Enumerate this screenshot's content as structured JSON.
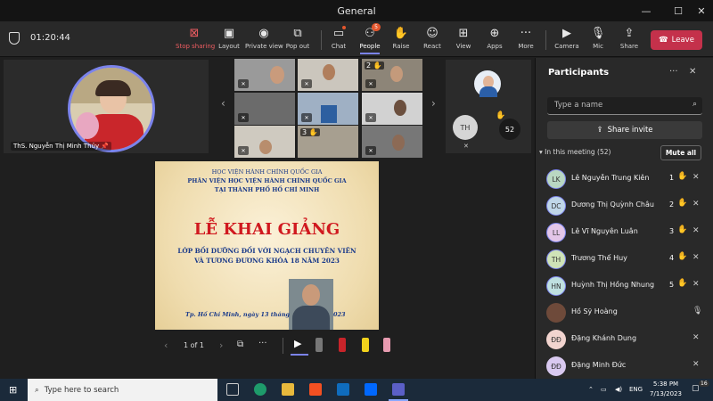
{
  "window": {
    "title": "General",
    "minimize": "—",
    "maximize": "☐",
    "close": "✕"
  },
  "toolbar": {
    "timer": "01:20:44",
    "stop_sharing": "Stop sharing",
    "layout": "Layout",
    "private_view": "Private view",
    "pop_out": "Pop out",
    "chat": "Chat",
    "people": "People",
    "people_badge": "5",
    "raise": "Raise",
    "react": "React",
    "view": "View",
    "apps": "Apps",
    "more": "More",
    "camera": "Camera",
    "mic": "Mic",
    "share": "Share",
    "leave": "Leave"
  },
  "stage": {
    "presenter_name": "ThS. Nguyễn Thị Minh Thủy",
    "hand_2": "2",
    "hand_3": "3",
    "side_initials": "TH",
    "side_count": "52"
  },
  "slide": {
    "line1": "HỌC VIỆN HÀNH CHÍNH QUỐC GIA",
    "line2": "PHÂN VIỆN HỌC VIỆN HÀNH CHÍNH QUỐC GIA",
    "line3": "TẠI THÀNH PHỐ HỒ CHÍ MINH",
    "title": "LỄ KHAI GIẢNG",
    "sub1": "LỚP BỒI DƯỠNG ĐỐI VỚI NGẠCH CHUYÊN VIÊN",
    "sub2": "VÀ TƯƠNG ĐƯƠNG KHÓA 18 NĂM 2023",
    "footer_left": "Tp. Hồ Chí Minh, ngày 13 tháng",
    "footer_right": "023",
    "page": "1 of 1"
  },
  "panel": {
    "title": "Participants",
    "search_placeholder": "Type a name",
    "invite": "Share invite",
    "in_meeting": "In this meeting (52)",
    "mute_all": "Mute all",
    "people": [
      {
        "initials": "LK",
        "name": "Lê Nguyễn Trung Kiên",
        "hand": "1",
        "color": "#b9d7c2"
      },
      {
        "initials": "DC",
        "name": "Dương Thị Quỳnh Châu",
        "hand": "2",
        "color": "#bfd6e8"
      },
      {
        "initials": "LL",
        "name": "Lê Vĩ Nguyên Luân",
        "hand": "3",
        "color": "#e3c6e8"
      },
      {
        "initials": "TH",
        "name": "Trương Thế Huy",
        "hand": "4",
        "color": "#cfe3b7"
      },
      {
        "initials": "HN",
        "name": "Huỳnh Thị Hồng Nhung",
        "hand": "5",
        "color": "#bfe0e0"
      },
      {
        "initials": "",
        "name": "Hồ Sỹ Hoàng",
        "hand": "",
        "color": "#6e4a3a"
      },
      {
        "initials": "ĐĐ",
        "name": "Đặng Khánh Dung",
        "hand": "",
        "color": "#f2d4cf"
      },
      {
        "initials": "ĐĐ",
        "name": "Đặng Minh Đức",
        "hand": "",
        "color": "#d9c9f0"
      }
    ]
  },
  "taskbar": {
    "search_placeholder": "Type here to search",
    "lang": "ENG",
    "time": "5:38 PM",
    "date": "7/13/2023",
    "notif": "16"
  }
}
